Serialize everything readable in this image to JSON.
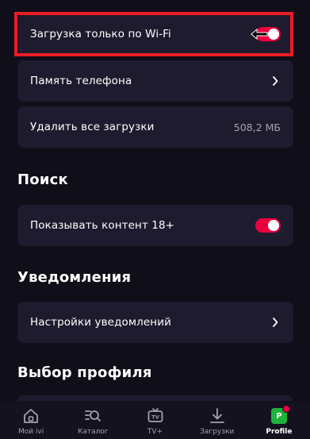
{
  "settings": {
    "wifi_only_label": "Загрузка только по Wi-Fi",
    "wifi_only_enabled": true,
    "phone_memory_label": "Память телефона",
    "delete_downloads_label": "Удалить все загрузки",
    "delete_downloads_size": "508,2 МБ"
  },
  "search_section": {
    "title": "Поиск",
    "adult_content_label": "Показывать контент 18+",
    "adult_content_enabled": true
  },
  "notifications_section": {
    "title": "Уведомления",
    "settings_label": "Настройки уведомлений"
  },
  "profile_section": {
    "title": "Выбор профиля"
  },
  "tabbar": {
    "items": [
      {
        "label": "Мой ivi",
        "icon": "home-icon"
      },
      {
        "label": "Каталог",
        "icon": "catalog-search-icon"
      },
      {
        "label": "TV+",
        "icon": "tv-icon"
      },
      {
        "label": "Загрузки",
        "icon": "download-icon"
      },
      {
        "label": "Profile",
        "icon": "avatar",
        "avatar_letter": "P",
        "active": true
      }
    ]
  },
  "colors": {
    "background": "#100e19",
    "card": "#1f1b2e",
    "accent": "#ea003d",
    "highlight": "#ec1c24",
    "avatar": "#1fb33c",
    "muted_text": "#a5a1b2"
  }
}
